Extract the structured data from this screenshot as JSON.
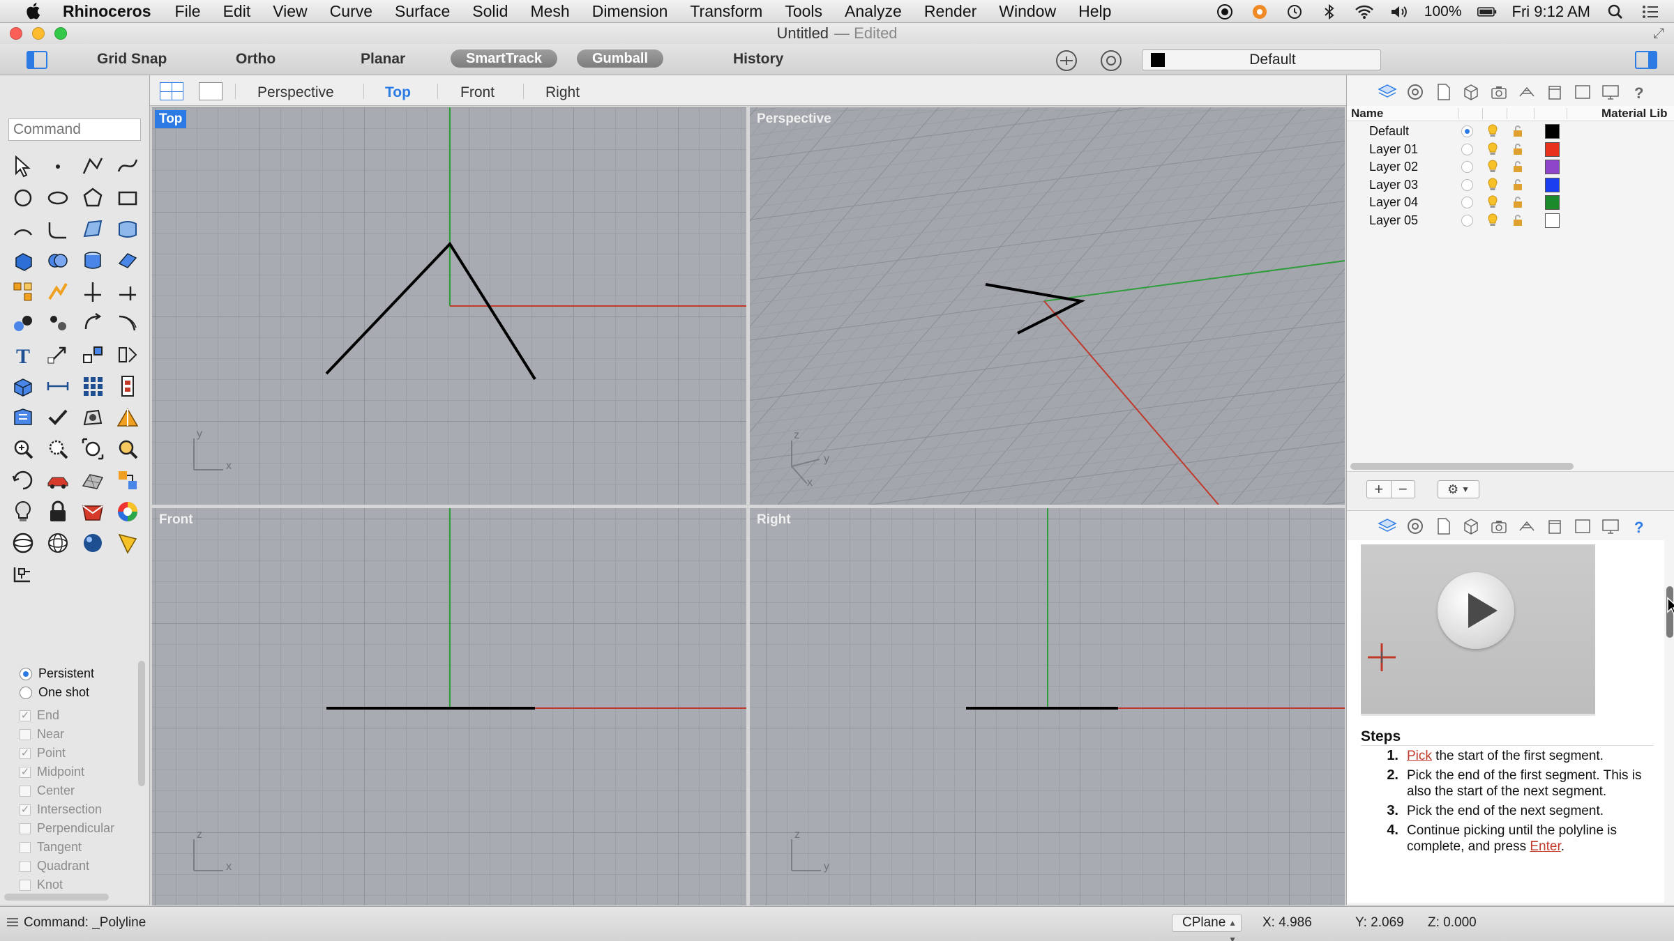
{
  "menubar": {
    "app_name": "Rhinoceros",
    "items": [
      "File",
      "Edit",
      "View",
      "Curve",
      "Surface",
      "Solid",
      "Mesh",
      "Dimension",
      "Transform",
      "Tools",
      "Analyze",
      "Render",
      "Window",
      "Help"
    ],
    "battery": "100%",
    "clock": "Fri 9:12 AM"
  },
  "window": {
    "title": "Untitled",
    "edited": "— Edited"
  },
  "toolbar": {
    "grid_snap": "Grid Snap",
    "ortho": "Ortho",
    "planar": "Planar",
    "smarttrack": "SmartTrack",
    "gumball": "Gumball",
    "history": "History",
    "current_layer": "Default"
  },
  "command": {
    "placeholder": "Command"
  },
  "viewport_tabs": [
    "Perspective",
    "Top",
    "Front",
    "Right"
  ],
  "viewports": {
    "top": "Top",
    "perspective": "Perspective",
    "front": "Front",
    "right": "Right"
  },
  "osnap": {
    "persistent": "Persistent",
    "one_shot": "One shot",
    "items": [
      {
        "label": "End",
        "checked": true
      },
      {
        "label": "Near",
        "checked": false
      },
      {
        "label": "Point",
        "checked": true
      },
      {
        "label": "Midpoint",
        "checked": true
      },
      {
        "label": "Center",
        "checked": false
      },
      {
        "label": "Intersection",
        "checked": true
      },
      {
        "label": "Perpendicular",
        "checked": false
      },
      {
        "label": "Tangent",
        "checked": false
      },
      {
        "label": "Quadrant",
        "checked": false
      },
      {
        "label": "Knot",
        "checked": false
      }
    ]
  },
  "layers": {
    "col_name": "Name",
    "col_material": "Material Lib",
    "rows": [
      {
        "name": "Default",
        "current": true,
        "color": "#000000"
      },
      {
        "name": "Layer 01",
        "current": false,
        "color": "#e8331c"
      },
      {
        "name": "Layer 02",
        "current": false,
        "color": "#8e44c9"
      },
      {
        "name": "Layer 03",
        "current": false,
        "color": "#1a3ff0"
      },
      {
        "name": "Layer 04",
        "current": false,
        "color": "#1a8a2a"
      },
      {
        "name": "Layer 05",
        "current": false,
        "color": "#ffffff"
      }
    ]
  },
  "help": {
    "steps_title": "Steps",
    "steps": [
      {
        "num": "1.",
        "link": "Pick",
        "text": " the start of the first segment."
      },
      {
        "num": "2.",
        "link": "",
        "text": "Pick the end of the first segment. This is also the start of the next segment."
      },
      {
        "num": "3.",
        "link": "",
        "text": "Pick the end of the next segment."
      },
      {
        "num": "4.",
        "link": "",
        "text": "Continue picking until the polyline is complete, and press ",
        "link_after": "Enter",
        "tail": "."
      }
    ]
  },
  "status": {
    "command": "Command: _Polyline",
    "cplane": "CPlane",
    "x": "X: 4.986",
    "y": "Y: 2.069",
    "z": "Z: 0.000"
  },
  "axes": {
    "x": "x",
    "y": "y",
    "z": "z"
  },
  "colors": {
    "accent": "#2c7be5",
    "x_axis": "#c0392b",
    "y_axis": "#2e9e3a",
    "curve": "#000000"
  }
}
